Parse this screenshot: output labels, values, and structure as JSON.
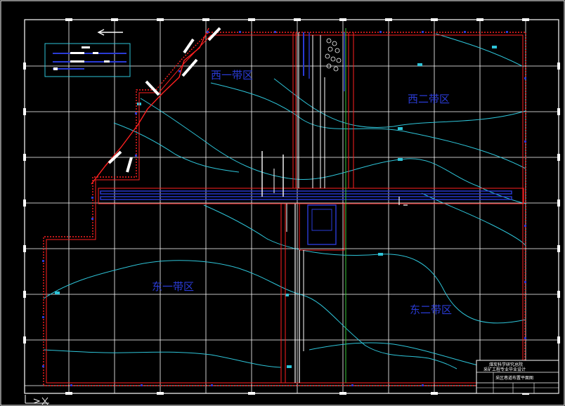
{
  "drawing": {
    "zones": [
      {
        "id": "west-1",
        "label": "西一带区"
      },
      {
        "id": "west-2",
        "label": "西二带区"
      },
      {
        "id": "east-1",
        "label": "东一带区"
      },
      {
        "id": "east-2",
        "label": "东二带区"
      }
    ],
    "title_block": {
      "line1": "煤炭科学研究总院",
      "line2": "采矿工程专业毕业设计",
      "line3": "采区巷道布置平面图"
    }
  },
  "colors": {
    "background": "#000000",
    "grid": "#ffffff",
    "boundary": "#ff2020",
    "roadway": "#2a3bd6",
    "contour": "#2ec4d8",
    "green_line": "#38c838",
    "zone_label": "#2a3bd6"
  }
}
